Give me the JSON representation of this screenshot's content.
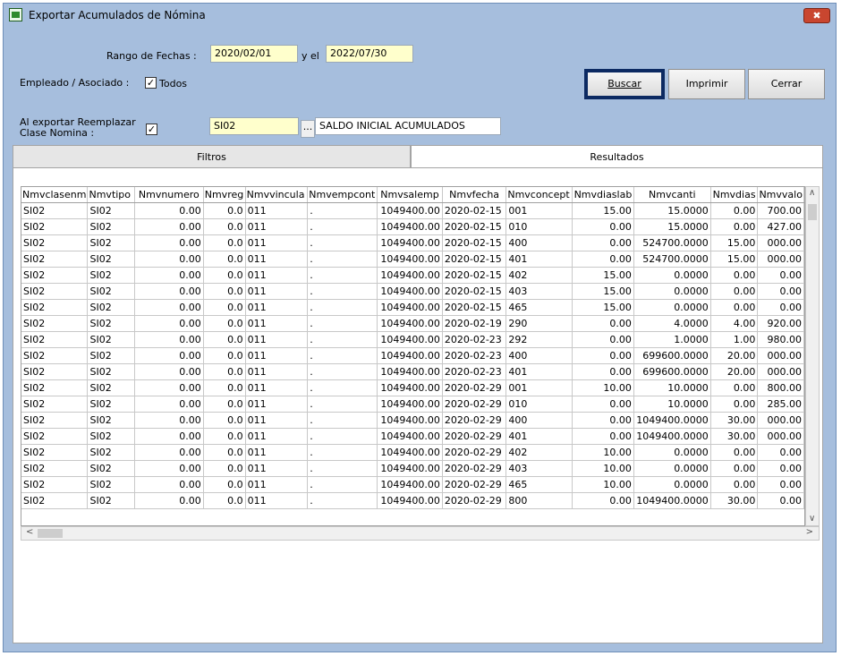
{
  "window": {
    "title": "Exportar Acumulados de Nómina",
    "close_glyph": "✖"
  },
  "filters": {
    "date_range_label": "Rango de Fechas :",
    "date_from": "2020/02/01",
    "date_connector": "y el",
    "date_to": "2022/07/30",
    "employee_label": "Empleado / Asociado :",
    "all_checked": true,
    "all_label": "Todos",
    "replace_label_line1": "Al exportar Reemplazar",
    "replace_label_line2": "Clase Nomina :",
    "replace_checked": true,
    "clase_code": "SI02",
    "clase_lookup": "...",
    "clase_description": "SALDO INICIAL ACUMULADOS"
  },
  "buttons": {
    "search": "Buscar",
    "print": "Imprimir",
    "close": "Cerrar"
  },
  "tabs": [
    {
      "label": "Filtros"
    },
    {
      "label": "Resultados"
    }
  ],
  "grid": {
    "columns": [
      "Nmvclasenm",
      "Nmvtipo",
      "Nmvnumero",
      "Nmvreg",
      "Nmvvincula",
      "Nmvempcont",
      "Nmvsalemp",
      "Nmvfecha",
      "Nmvconcept",
      "Nmvdiaslab",
      "Nmvcanti",
      "Nmvdias",
      "Nmvvalo"
    ],
    "rows": [
      [
        "SI02",
        "SI02",
        "0.00",
        "0.0",
        "011",
        ".",
        "1049400.00",
        "2020-02-15",
        "001",
        "15.00",
        "15.0000",
        "0.00",
        "700.00"
      ],
      [
        "SI02",
        "SI02",
        "0.00",
        "0.0",
        "011",
        ".",
        "1049400.00",
        "2020-02-15",
        "010",
        "0.00",
        "15.0000",
        "0.00",
        "427.00"
      ],
      [
        "SI02",
        "SI02",
        "0.00",
        "0.0",
        "011",
        ".",
        "1049400.00",
        "2020-02-15",
        "400",
        "0.00",
        "524700.0000",
        "15.00",
        "000.00"
      ],
      [
        "SI02",
        "SI02",
        "0.00",
        "0.0",
        "011",
        ".",
        "1049400.00",
        "2020-02-15",
        "401",
        "0.00",
        "524700.0000",
        "15.00",
        "000.00"
      ],
      [
        "SI02",
        "SI02",
        "0.00",
        "0.0",
        "011",
        ".",
        "1049400.00",
        "2020-02-15",
        "402",
        "15.00",
        "0.0000",
        "0.00",
        "0.00"
      ],
      [
        "SI02",
        "SI02",
        "0.00",
        "0.0",
        "011",
        ".",
        "1049400.00",
        "2020-02-15",
        "403",
        "15.00",
        "0.0000",
        "0.00",
        "0.00"
      ],
      [
        "SI02",
        "SI02",
        "0.00",
        "0.0",
        "011",
        ".",
        "1049400.00",
        "2020-02-15",
        "465",
        "15.00",
        "0.0000",
        "0.00",
        "0.00"
      ],
      [
        "SI02",
        "SI02",
        "0.00",
        "0.0",
        "011",
        ".",
        "1049400.00",
        "2020-02-19",
        "290",
        "0.00",
        "4.0000",
        "4.00",
        "920.00"
      ],
      [
        "SI02",
        "SI02",
        "0.00",
        "0.0",
        "011",
        ".",
        "1049400.00",
        "2020-02-23",
        "292",
        "0.00",
        "1.0000",
        "1.00",
        "980.00"
      ],
      [
        "SI02",
        "SI02",
        "0.00",
        "0.0",
        "011",
        ".",
        "1049400.00",
        "2020-02-23",
        "400",
        "0.00",
        "699600.0000",
        "20.00",
        "000.00"
      ],
      [
        "SI02",
        "SI02",
        "0.00",
        "0.0",
        "011",
        ".",
        "1049400.00",
        "2020-02-23",
        "401",
        "0.00",
        "699600.0000",
        "20.00",
        "000.00"
      ],
      [
        "SI02",
        "SI02",
        "0.00",
        "0.0",
        "011",
        ".",
        "1049400.00",
        "2020-02-29",
        "001",
        "10.00",
        "10.0000",
        "0.00",
        "800.00"
      ],
      [
        "SI02",
        "SI02",
        "0.00",
        "0.0",
        "011",
        ".",
        "1049400.00",
        "2020-02-29",
        "010",
        "0.00",
        "10.0000",
        "0.00",
        "285.00"
      ],
      [
        "SI02",
        "SI02",
        "0.00",
        "0.0",
        "011",
        ".",
        "1049400.00",
        "2020-02-29",
        "400",
        "0.00",
        "1049400.0000",
        "30.00",
        "000.00"
      ],
      [
        "SI02",
        "SI02",
        "0.00",
        "0.0",
        "011",
        ".",
        "1049400.00",
        "2020-02-29",
        "401",
        "0.00",
        "1049400.0000",
        "30.00",
        "000.00"
      ],
      [
        "SI02",
        "SI02",
        "0.00",
        "0.0",
        "011",
        ".",
        "1049400.00",
        "2020-02-29",
        "402",
        "10.00",
        "0.0000",
        "0.00",
        "0.00"
      ],
      [
        "SI02",
        "SI02",
        "0.00",
        "0.0",
        "011",
        ".",
        "1049400.00",
        "2020-02-29",
        "403",
        "10.00",
        "0.0000",
        "0.00",
        "0.00"
      ],
      [
        "SI02",
        "SI02",
        "0.00",
        "0.0",
        "011",
        ".",
        "1049400.00",
        "2020-02-29",
        "465",
        "10.00",
        "0.0000",
        "0.00",
        "0.00"
      ],
      [
        "SI02",
        "SI02",
        "0.00",
        "0.0",
        "011",
        ".",
        "1049400.00",
        "2020-02-29",
        "800",
        "0.00",
        "1049400.0000",
        "30.00",
        "0.00"
      ]
    ]
  },
  "scroll": {
    "up": "∧",
    "down": "∨",
    "left": "<",
    "right": ">"
  }
}
